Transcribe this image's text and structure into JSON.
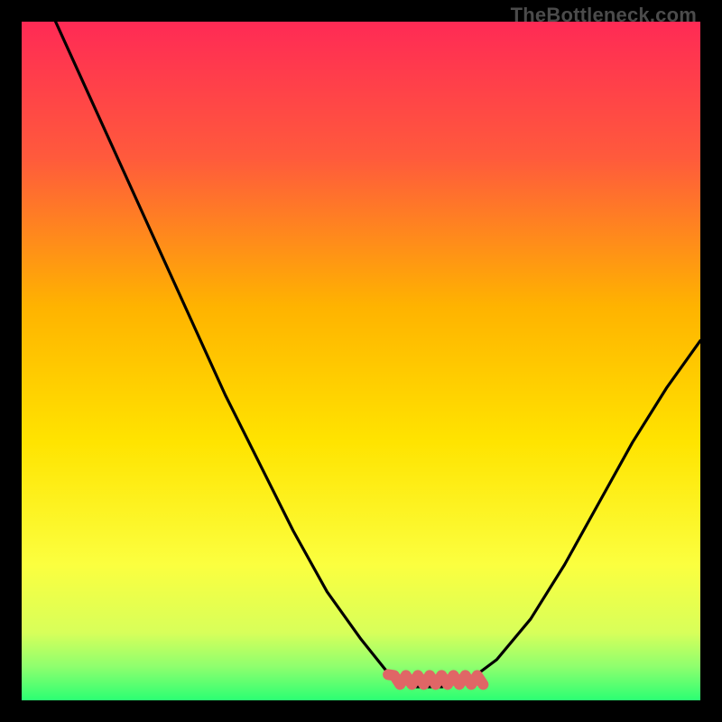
{
  "watermark": "TheBottleneck.com",
  "colors": {
    "frame": "#000000",
    "curve": "#000000",
    "squiggle": "#e06666",
    "gradient_stops": [
      {
        "offset": 0.0,
        "color": "#ff2a55"
      },
      {
        "offset": 0.2,
        "color": "#ff5a3c"
      },
      {
        "offset": 0.42,
        "color": "#ffb300"
      },
      {
        "offset": 0.62,
        "color": "#ffe400"
      },
      {
        "offset": 0.8,
        "color": "#fbff3f"
      },
      {
        "offset": 0.9,
        "color": "#d8ff5a"
      },
      {
        "offset": 0.95,
        "color": "#8fff6e"
      },
      {
        "offset": 1.0,
        "color": "#2bff73"
      }
    ]
  },
  "chart_data": {
    "type": "line",
    "title": "",
    "xlabel": "",
    "ylabel": "",
    "xlim": [
      0,
      1
    ],
    "ylim": [
      0,
      1
    ],
    "series": [
      {
        "name": "bottleneck-curve",
        "x": [
          0.05,
          0.1,
          0.15,
          0.2,
          0.25,
          0.3,
          0.35,
          0.4,
          0.45,
          0.5,
          0.54,
          0.58,
          0.62,
          0.66,
          0.7,
          0.75,
          0.8,
          0.85,
          0.9,
          0.95,
          1.0
        ],
        "y": [
          1.0,
          0.89,
          0.78,
          0.67,
          0.56,
          0.45,
          0.35,
          0.25,
          0.16,
          0.09,
          0.04,
          0.02,
          0.02,
          0.03,
          0.06,
          0.12,
          0.2,
          0.29,
          0.38,
          0.46,
          0.53
        ]
      }
    ],
    "flat_region": {
      "x_start": 0.54,
      "x_end": 0.68,
      "y": 0.03
    }
  }
}
